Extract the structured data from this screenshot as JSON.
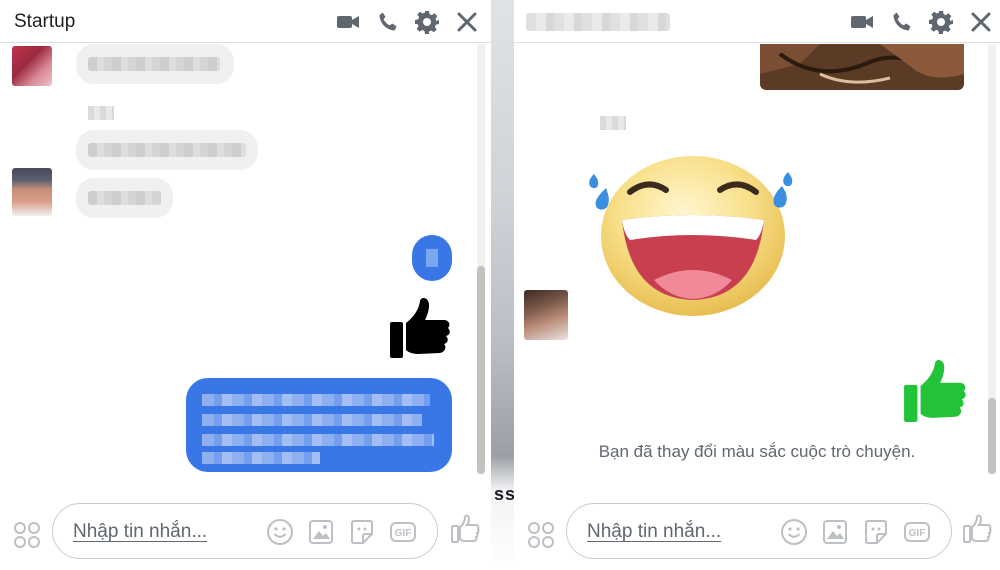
{
  "left_chat": {
    "title": "Startup",
    "header_icons": [
      "video-camera-icon",
      "phone-icon",
      "gear-icon",
      "close-icon"
    ],
    "composer": {
      "placeholder": "Nhập tin nhắn...",
      "tools": [
        "smiley-icon",
        "photo-icon",
        "sticker-icon",
        "gif-icon"
      ],
      "gif_label": "GIF",
      "send_icon": "thumbs-up-icon"
    },
    "like_color": "#000000"
  },
  "right_chat": {
    "header_icons": [
      "video-camera-icon",
      "phone-icon",
      "gear-icon",
      "close-icon"
    ],
    "system_message": "Bạn đã thay đổi màu sắc cuộc trò chuyện.",
    "composer": {
      "placeholder": "Nhập tin nhắn...",
      "tools": [
        "smiley-icon",
        "photo-icon",
        "sticker-icon",
        "gif-icon"
      ],
      "gif_label": "GIF",
      "send_icon": "thumbs-up-icon"
    },
    "like_color": "#22c339"
  },
  "divider_text": "ss",
  "colors": {
    "messenger_blue": "#3a77e6",
    "bubble_grey": "#f0f0f0",
    "border": "#dddfe2",
    "text": "#1c1e21"
  }
}
